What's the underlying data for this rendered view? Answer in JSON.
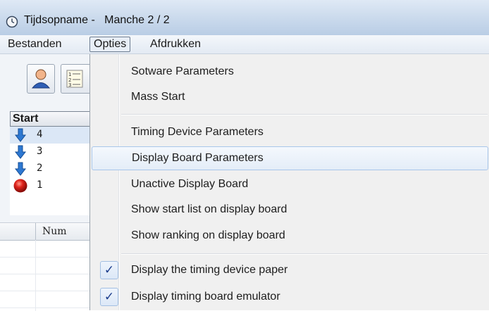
{
  "window": {
    "title": "Tijdsopname -   Manche 2 / 2"
  },
  "menubar": {
    "items": [
      {
        "label": "Bestanden"
      },
      {
        "label": "Opties"
      },
      {
        "label": "Afdrukken"
      }
    ]
  },
  "toolbar": {
    "buttons": [
      {
        "icon": "user-icon"
      },
      {
        "icon": "numbered-list-icon"
      }
    ]
  },
  "start_list": {
    "header": "Start",
    "rows": [
      {
        "num": "4",
        "icon": "arrow-down-icon"
      },
      {
        "num": "3",
        "icon": "arrow-down-icon"
      },
      {
        "num": "2",
        "icon": "arrow-down-icon"
      },
      {
        "num": "1",
        "icon": "red-ball-icon"
      }
    ]
  },
  "grid": {
    "columns": [
      "",
      "Num"
    ]
  },
  "dropdown": {
    "items": [
      {
        "label": "Sotware Parameters"
      },
      {
        "label": "Mass Start"
      },
      {
        "label": "Timing Device Parameters"
      },
      {
        "label": "Display Board Parameters"
      },
      {
        "label": "Unactive Display Board"
      },
      {
        "label": "Show start list on display board"
      },
      {
        "label": "Show ranking on display board"
      },
      {
        "label": "Display the timing device paper",
        "checked": true
      },
      {
        "label": "Display timing board emulator",
        "checked": true
      }
    ],
    "check_glyph": "✓"
  },
  "colors": {
    "accent": "#1c3d8c",
    "hover_border": "#a8c6ea"
  }
}
